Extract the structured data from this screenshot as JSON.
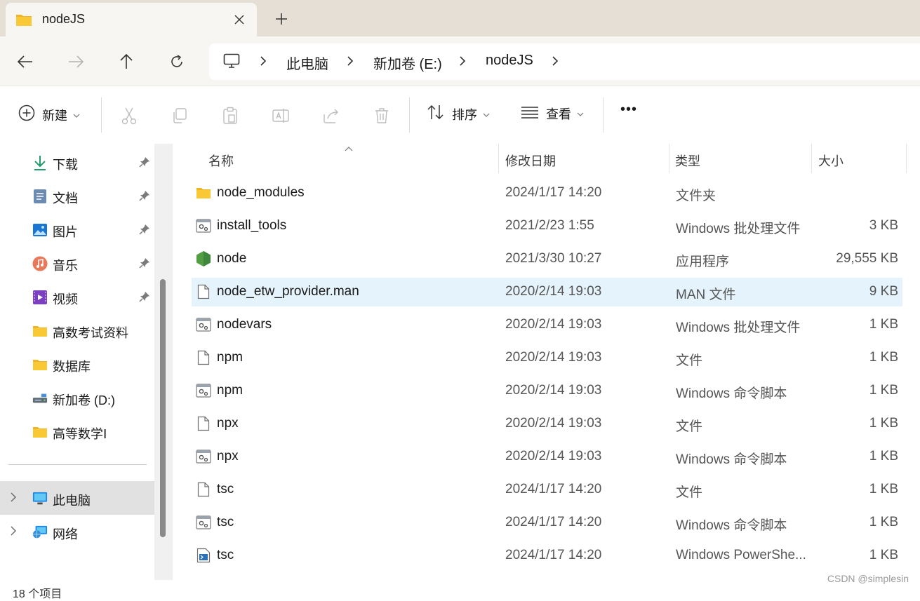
{
  "tab": {
    "title": "nodeJS",
    "new_tab": "+"
  },
  "breadcrumb": [
    "此电脑",
    "新加卷 (E:)",
    "nodeJS"
  ],
  "toolbar": {
    "new_label": "新建",
    "sort_label": "排序",
    "view_label": "查看",
    "more_label": "•••"
  },
  "sidebar": {
    "items": [
      {
        "label": "下载",
        "icon": "download-icon",
        "pinned": true
      },
      {
        "label": "文档",
        "icon": "document-icon",
        "pinned": true
      },
      {
        "label": "图片",
        "icon": "pictures-icon",
        "pinned": true
      },
      {
        "label": "音乐",
        "icon": "music-icon",
        "pinned": true
      },
      {
        "label": "视频",
        "icon": "video-icon",
        "pinned": true
      },
      {
        "label": "高数考试资料",
        "icon": "folder-icon",
        "pinned": false
      },
      {
        "label": "数据库",
        "icon": "folder-icon",
        "pinned": false
      },
      {
        "label": "新加卷 (D:)",
        "icon": "drive-icon",
        "pinned": false
      },
      {
        "label": "高等数学Ⅰ",
        "icon": "folder-icon",
        "pinned": false
      }
    ],
    "tree": [
      {
        "label": "此电脑",
        "icon": "pc-icon",
        "selected": true
      },
      {
        "label": "网络",
        "icon": "network-icon",
        "selected": false
      }
    ],
    "status": "18 个项目"
  },
  "columns": {
    "name": "名称",
    "date": "修改日期",
    "type": "类型",
    "size": "大小"
  },
  "files": [
    {
      "name": "node_modules",
      "date": "2024/1/17 14:20",
      "type": "文件夹",
      "size": "",
      "icon": "folder-icon"
    },
    {
      "name": "install_tools",
      "date": "2021/2/23 1:55",
      "type": "Windows 批处理文件",
      "size": "3 KB",
      "icon": "batch-file-icon"
    },
    {
      "name": "node",
      "date": "2021/3/30 10:27",
      "type": "应用程序",
      "size": "29,555 KB",
      "icon": "nodejs-icon"
    },
    {
      "name": "node_etw_provider.man",
      "date": "2020/2/14 19:03",
      "type": "MAN 文件",
      "size": "9 KB",
      "icon": "file-icon",
      "selected": true
    },
    {
      "name": "nodevars",
      "date": "2020/2/14 19:03",
      "type": "Windows 批处理文件",
      "size": "1 KB",
      "icon": "batch-file-icon"
    },
    {
      "name": "npm",
      "date": "2020/2/14 19:03",
      "type": "文件",
      "size": "1 KB",
      "icon": "file-icon"
    },
    {
      "name": "npm",
      "date": "2020/2/14 19:03",
      "type": "Windows 命令脚本",
      "size": "1 KB",
      "icon": "batch-file-icon"
    },
    {
      "name": "npx",
      "date": "2020/2/14 19:03",
      "type": "文件",
      "size": "1 KB",
      "icon": "file-icon"
    },
    {
      "name": "npx",
      "date": "2020/2/14 19:03",
      "type": "Windows 命令脚本",
      "size": "1 KB",
      "icon": "batch-file-icon"
    },
    {
      "name": "tsc",
      "date": "2024/1/17 14:20",
      "type": "文件",
      "size": "1 KB",
      "icon": "file-icon"
    },
    {
      "name": "tsc",
      "date": "2024/1/17 14:20",
      "type": "Windows 命令脚本",
      "size": "1 KB",
      "icon": "batch-file-icon"
    },
    {
      "name": "tsc",
      "date": "2024/1/17 14:20",
      "type": "Windows PowerShe...",
      "size": "1 KB",
      "icon": "powershell-icon"
    }
  ],
  "watermark": "CSDN @simplesin",
  "colors": {
    "accent": "#0067c0",
    "selection": "#e5f3fd",
    "tabbar": "#e6dfd6",
    "folder": "#f8c935"
  }
}
